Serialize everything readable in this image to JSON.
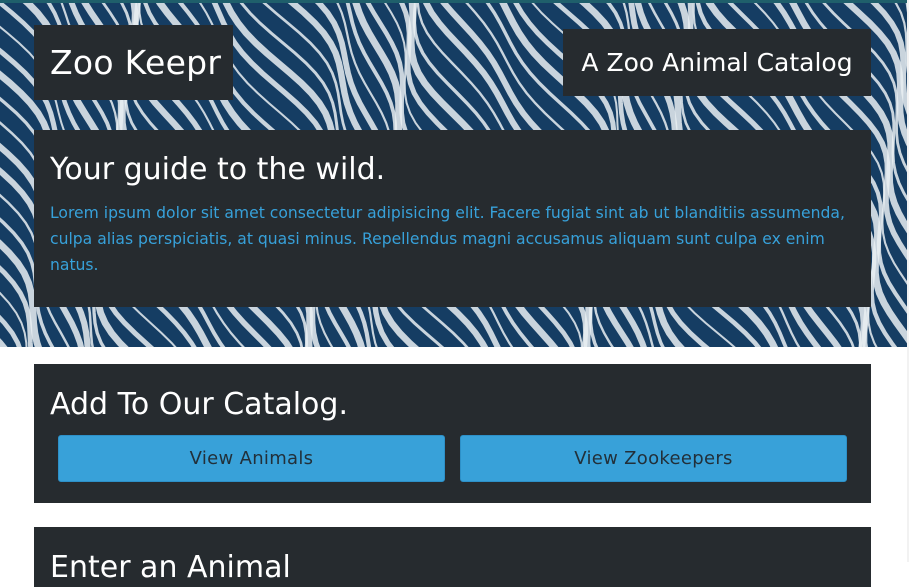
{
  "header": {
    "brand": "Zoo Keepr",
    "subtitle": "A Zoo Animal Catalog"
  },
  "intro": {
    "heading": "Your guide to the wild.",
    "body": "Lorem ipsum dolor sit amet consectetur adipisicing elit. Facere fugiat sint ab ut blanditiis assumenda, culpa alias perspiciatis, at quasi minus. Repellendus magni accusamus aliquam sunt culpa ex enim natus."
  },
  "catalog": {
    "heading": "Add To Our Catalog.",
    "buttons": {
      "animals": "View Animals",
      "zookeepers": "View Zookeepers"
    }
  },
  "enter_animal": {
    "heading": "Enter an Animal"
  },
  "colors": {
    "panel_bg": "#262b2f",
    "accent": "#38a1d9",
    "hero_blue": "#153d63",
    "stripe": "#e9eef2"
  }
}
